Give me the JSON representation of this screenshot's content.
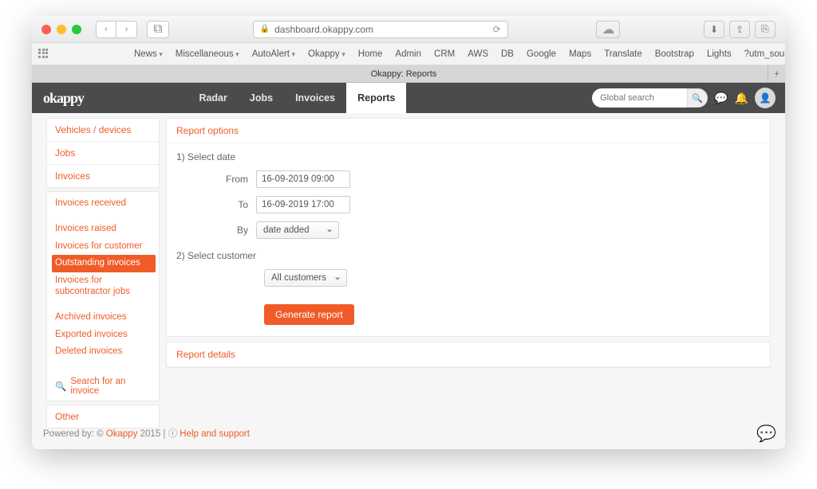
{
  "browser": {
    "url_host": "dashboard.okappy.com",
    "bookmarks": [
      "News",
      "Miscellaneous",
      "AutoAlert",
      "Okappy",
      "Home",
      "Admin",
      "CRM",
      "AWS",
      "DB",
      "Google",
      "Maps",
      "Translate",
      "Bootstrap",
      "Lights",
      "?utm_source=i…ign=internal"
    ],
    "bookmarks_caret": [
      true,
      true,
      true,
      true,
      false,
      false,
      false,
      false,
      false,
      false,
      false,
      false,
      false,
      false,
      false
    ],
    "tab_title": "Okappy: Reports"
  },
  "app": {
    "logo": "okappy",
    "nav": [
      "Radar",
      "Jobs",
      "Invoices",
      "Reports"
    ],
    "nav_active_index": 3,
    "search_placeholder": "Global search"
  },
  "sidebar": {
    "top_groups": [
      "Vehicles / devices",
      "Jobs",
      "Invoices"
    ],
    "invoice_items": [
      "Invoices received",
      "Invoices raised",
      "Invoices for customer",
      "Outstanding invoices",
      "Invoices for subcontractor jobs",
      "Archived invoices",
      "Exported invoices",
      "Deleted invoices"
    ],
    "invoice_selected_index": 3,
    "search_label": "Search for an invoice",
    "other_label": "Other"
  },
  "report": {
    "options_title": "Report options",
    "step1": "1) Select date",
    "from_label": "From",
    "from_value": "16-09-2019 09:00",
    "to_label": "To",
    "to_value": "16-09-2019 17:00",
    "by_label": "By",
    "by_value": "date added",
    "step2": "2) Select customer",
    "customer_value": "All customers",
    "generate_label": "Generate report",
    "details_title": "Report details"
  },
  "footer": {
    "prefix": "Powered by: © ",
    "brand": "Okappy",
    "year": " 2015 | ",
    "help": "Help and support"
  }
}
